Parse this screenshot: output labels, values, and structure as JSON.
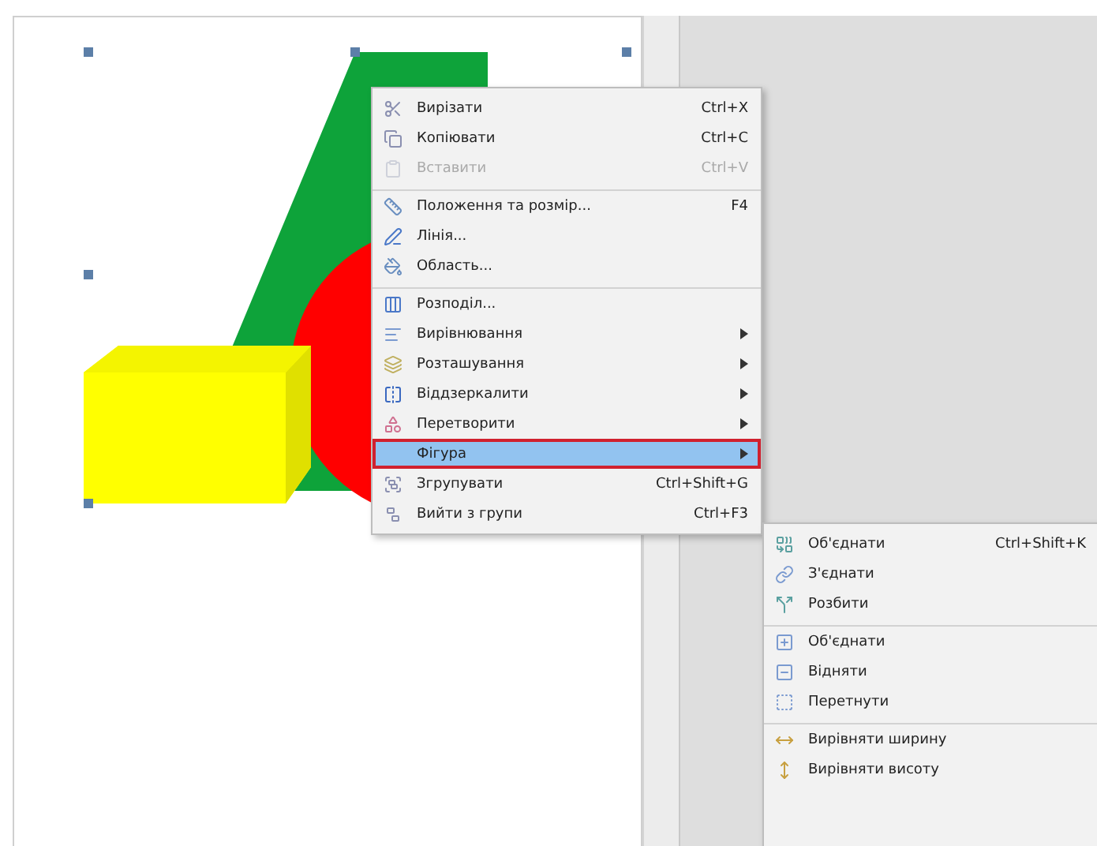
{
  "context_menu": {
    "items": [
      {
        "label": "Вирізати",
        "shortcut": "Ctrl+X",
        "disabled": false,
        "submenu": false,
        "selected": false,
        "separator_before": false
      },
      {
        "label": "Копіювати",
        "shortcut": "Ctrl+C",
        "disabled": false,
        "submenu": false,
        "selected": false,
        "separator_before": false
      },
      {
        "label": "Вставити",
        "shortcut": "Ctrl+V",
        "disabled": true,
        "submenu": false,
        "selected": false,
        "separator_before": false
      },
      {
        "label": "Положення та розмір...",
        "shortcut": "F4",
        "disabled": false,
        "submenu": false,
        "selected": false,
        "separator_before": true
      },
      {
        "label": "Лінія...",
        "disabled": false,
        "submenu": false,
        "selected": false,
        "separator_before": false
      },
      {
        "label": "Область...",
        "disabled": false,
        "submenu": false,
        "selected": false,
        "separator_before": false
      },
      {
        "label": "Розподіл...",
        "disabled": false,
        "submenu": false,
        "selected": false,
        "separator_before": true
      },
      {
        "label": "Вирівнювання",
        "disabled": false,
        "submenu": true,
        "selected": false,
        "separator_before": false
      },
      {
        "label": "Розташування",
        "disabled": false,
        "submenu": true,
        "selected": false,
        "separator_before": false
      },
      {
        "label": "Віддзеркалити",
        "disabled": false,
        "submenu": true,
        "selected": false,
        "separator_before": false
      },
      {
        "label": "Перетворити",
        "disabled": false,
        "submenu": true,
        "selected": false,
        "separator_before": false
      },
      {
        "label": "Фігура",
        "disabled": false,
        "submenu": true,
        "selected": true,
        "separator_before": false
      },
      {
        "label": "Згрупувати",
        "shortcut": "Ctrl+Shift+G",
        "disabled": false,
        "submenu": false,
        "selected": false,
        "separator_before": false
      },
      {
        "label": "Вийти з групи",
        "shortcut": "Ctrl+F3",
        "disabled": false,
        "submenu": false,
        "selected": false,
        "separator_before": false
      }
    ]
  },
  "shape_submenu": {
    "items": [
      {
        "label": "Об'єднати",
        "shortcut": "Ctrl+Shift+K",
        "separator_before": false
      },
      {
        "label": "З'єднати",
        "separator_before": false
      },
      {
        "label": "Розбити",
        "separator_before": false
      },
      {
        "label": "Об'єднати",
        "separator_before": true
      },
      {
        "label": "Відняти",
        "separator_before": false
      },
      {
        "label": "Перетнути",
        "separator_before": false
      },
      {
        "label": "Вирівняти ширину",
        "separator_before": true
      },
      {
        "label": "Вирівняти висоту",
        "separator_before": false
      }
    ]
  }
}
